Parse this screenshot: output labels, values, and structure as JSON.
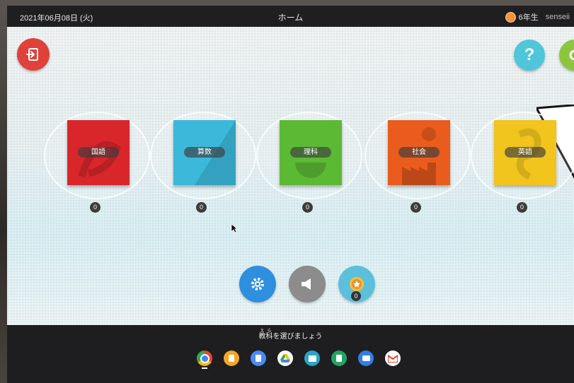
{
  "status_bar": {
    "date": "2021年06月08日 (火)",
    "title": "ホーム",
    "user_grade": "6年生",
    "user_name": "senseii"
  },
  "subjects": [
    {
      "label": "国語",
      "count": "0",
      "color": "#d8262b"
    },
    {
      "label": "算数",
      "count": "0",
      "color": "#3bb8da"
    },
    {
      "label": "理科",
      "count": "0",
      "color": "#5cb934"
    },
    {
      "label": "社会",
      "count": "0",
      "color": "#ea5c1e"
    },
    {
      "label": "英語",
      "count": "0",
      "color": "#f1c41e"
    }
  ],
  "bottom_buttons": [
    {
      "name": "settings",
      "color": "#2f8fdf"
    },
    {
      "name": "announcement",
      "color": "#8c8c8c"
    },
    {
      "name": "badge",
      "color": "#5cc0dc",
      "count": "0"
    }
  ],
  "footer": {
    "instruction": "教科を選びましょう",
    "ruby_base": "教科",
    "ruby_text": "えら",
    "rest": "を選びましょう"
  },
  "shelf_apps": [
    "chrome-icon",
    "files-icon",
    "docs-icon",
    "drive-icon",
    "classroom-icon",
    "sheets-icon",
    "camera-icon",
    "gmail-icon"
  ],
  "help_label": "?"
}
